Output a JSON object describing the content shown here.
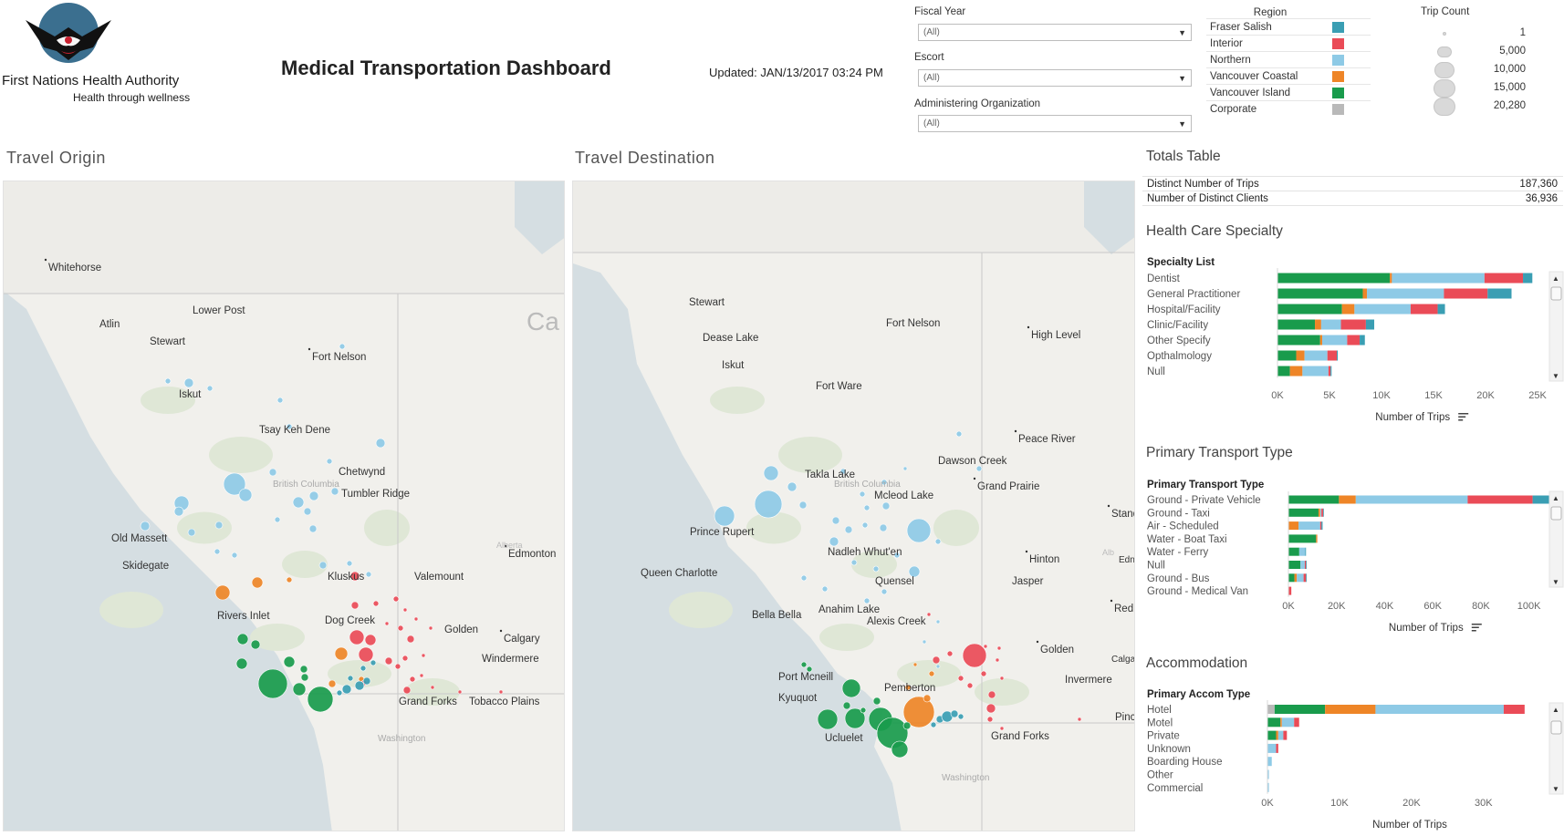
{
  "header": {
    "org_name": "First Nations Health Authority",
    "org_tagline": "Health through wellness",
    "title": "Medical Transportation Dashboard",
    "updated": "Updated: JAN/13/2017 03:24 PM"
  },
  "filters": [
    {
      "label": "Fiscal Year",
      "value": "(All)"
    },
    {
      "label": "Escort",
      "value": "(All)"
    },
    {
      "label": "Administering Organization",
      "value": "(All)"
    }
  ],
  "region_legend": {
    "title": "Region",
    "items": [
      {
        "name": "Fraser Salish",
        "color": "#3a9eb3"
      },
      {
        "name": "Interior",
        "color": "#ea4b57"
      },
      {
        "name": "Northern",
        "color": "#8ecae6"
      },
      {
        "name": "Vancouver Coastal",
        "color": "#ee8527"
      },
      {
        "name": "Vancouver Island",
        "color": "#199b4c"
      },
      {
        "name": "Corporate",
        "color": "#b9b9b9"
      }
    ]
  },
  "trip_count_legend": {
    "title": "Trip Count",
    "values": [
      "1",
      "5,000",
      "10,000",
      "15,000",
      "20,280"
    ]
  },
  "maps": {
    "origin": {
      "title": "Travel Origin",
      "places": [
        "Whitehorse",
        "Lower Post",
        "Atlin",
        "Stewart",
        "Fort Nelson",
        "Iskut",
        "Tsay Keh Dene",
        "Chetwynd",
        "Tumbler Ridge",
        "Old Massett",
        "Skidegate",
        "Edmonton",
        "Kluskus",
        "Valemount",
        "Rivers Inlet",
        "Dog Creek",
        "Golden",
        "Calgary",
        "Windermere",
        "Grand Forks",
        "Tobacco Plains",
        "British Columbia",
        "Washington",
        "Ca",
        "Alberta"
      ]
    },
    "destination": {
      "title": "Travel Destination",
      "places": [
        "Stewart",
        "Fort Nelson",
        "High Level",
        "Dease Lake",
        "Iskut",
        "Fort Ware",
        "Peace River",
        "Dawson Creek",
        "Grand Prairie",
        "Takla Lake",
        "Mcleod Lake",
        "Standoff",
        "Prince Rupert",
        "Nadleh Whut'en",
        "Hinton",
        "Queen Charlotte",
        "Quensel",
        "Jasper",
        "Anahim Lake",
        "Bella Bella",
        "Alexis Creek",
        "Red",
        "Golden",
        "Port Mcneill",
        "Pemberton",
        "Invermere",
        "Kyuquot",
        "Ucluelet",
        "Grand Forks",
        "Pincher",
        "British Columbia",
        "Washington",
        "Edn",
        "Alb",
        "Calga"
      ]
    }
  },
  "totals": {
    "title": "Totals Table",
    "rows": [
      {
        "label": "Distinct Number of Trips",
        "value": "187,360"
      },
      {
        "label": "Number of Distinct Clients",
        "value": "36,936"
      }
    ]
  },
  "chart_data": [
    {
      "type": "bar",
      "orientation": "horizontal-stacked",
      "title": "Health Care Specialty",
      "category_header": "Specialty List",
      "xlabel": "Number of Trips",
      "xlim": [
        0,
        25000
      ],
      "x_ticks": [
        "0K",
        "5K",
        "10K",
        "15K",
        "20K",
        "25K"
      ],
      "categories": [
        "Dentist",
        "General Practitioner",
        "Hospital/Facility",
        "Clinic/Facility",
        "Other Specify",
        "Opthalmology",
        "Null"
      ],
      "series": [
        {
          "name": "Vancouver Island",
          "values": [
            10800,
            8200,
            6200,
            3600,
            4100,
            1800,
            1200
          ]
        },
        {
          "name": "Vancouver Coastal",
          "values": [
            200,
            400,
            1200,
            600,
            200,
            800,
            1200
          ]
        },
        {
          "name": "Northern",
          "values": [
            8900,
            7400,
            5400,
            1900,
            2400,
            2200,
            2500
          ]
        },
        {
          "name": "Interior",
          "values": [
            3700,
            4200,
            2600,
            2400,
            1200,
            900,
            200
          ]
        },
        {
          "name": "Fraser Salish",
          "values": [
            900,
            2300,
            700,
            800,
            500,
            100,
            100
          ]
        }
      ]
    },
    {
      "type": "bar",
      "orientation": "horizontal-stacked",
      "title": "Primary Transport Type",
      "category_header": "Primary Transport Type",
      "xlabel": "Number of Trips",
      "xlim": [
        0,
        110000
      ],
      "x_ticks": [
        "0K",
        "20K",
        "40K",
        "60K",
        "80K",
        "100K"
      ],
      "categories": [
        "Ground - Private Vehicle",
        "Ground - Taxi",
        "Air - Scheduled",
        "Water - Boat Taxi",
        "Water - Ferry",
        "Null",
        "Ground - Bus",
        "Ground - Medical Van"
      ],
      "series": [
        {
          "name": "Vancouver Island",
          "values": [
            21000,
            12500,
            0,
            11500,
            4500,
            5000,
            2500,
            0
          ]
        },
        {
          "name": "Vancouver Coastal",
          "values": [
            7000,
            700,
            4200,
            500,
            0,
            0,
            1000,
            0
          ]
        },
        {
          "name": "Northern",
          "values": [
            46500,
            500,
            9000,
            0,
            2500,
            1800,
            2800,
            0
          ]
        },
        {
          "name": "Interior",
          "values": [
            27000,
            700,
            500,
            0,
            0,
            500,
            1000,
            1200
          ]
        },
        {
          "name": "Fraser Salish",
          "values": [
            7500,
            300,
            500,
            0,
            300,
            300,
            300,
            0
          ]
        }
      ]
    },
    {
      "type": "bar",
      "orientation": "horizontal-stacked",
      "title": "Accommodation",
      "category_header": "Primary Accom Type",
      "xlabel": "Number of Trips",
      "xlim": [
        0,
        38000
      ],
      "x_ticks": [
        "0K",
        "10K",
        "20K",
        "30K"
      ],
      "categories": [
        "Hotel",
        "Motel",
        "Private",
        "Unknown",
        "Boarding House",
        "Other",
        "Commercial"
      ],
      "series": [
        {
          "name": "Corporate",
          "values": [
            1000,
            0,
            0,
            0,
            0,
            0,
            0
          ]
        },
        {
          "name": "Vancouver Island",
          "values": [
            7000,
            1800,
            1200,
            0,
            0,
            0,
            0
          ]
        },
        {
          "name": "Vancouver Coastal",
          "values": [
            7000,
            200,
            300,
            0,
            0,
            0,
            0
          ]
        },
        {
          "name": "Northern",
          "values": [
            17800,
            1700,
            700,
            1200,
            600,
            200,
            200
          ]
        },
        {
          "name": "Interior",
          "values": [
            2900,
            700,
            500,
            300,
            0,
            0,
            0
          ]
        },
        {
          "name": "Fraser Salish",
          "values": [
            0,
            0,
            0,
            0,
            0,
            0,
            0
          ]
        }
      ]
    }
  ]
}
